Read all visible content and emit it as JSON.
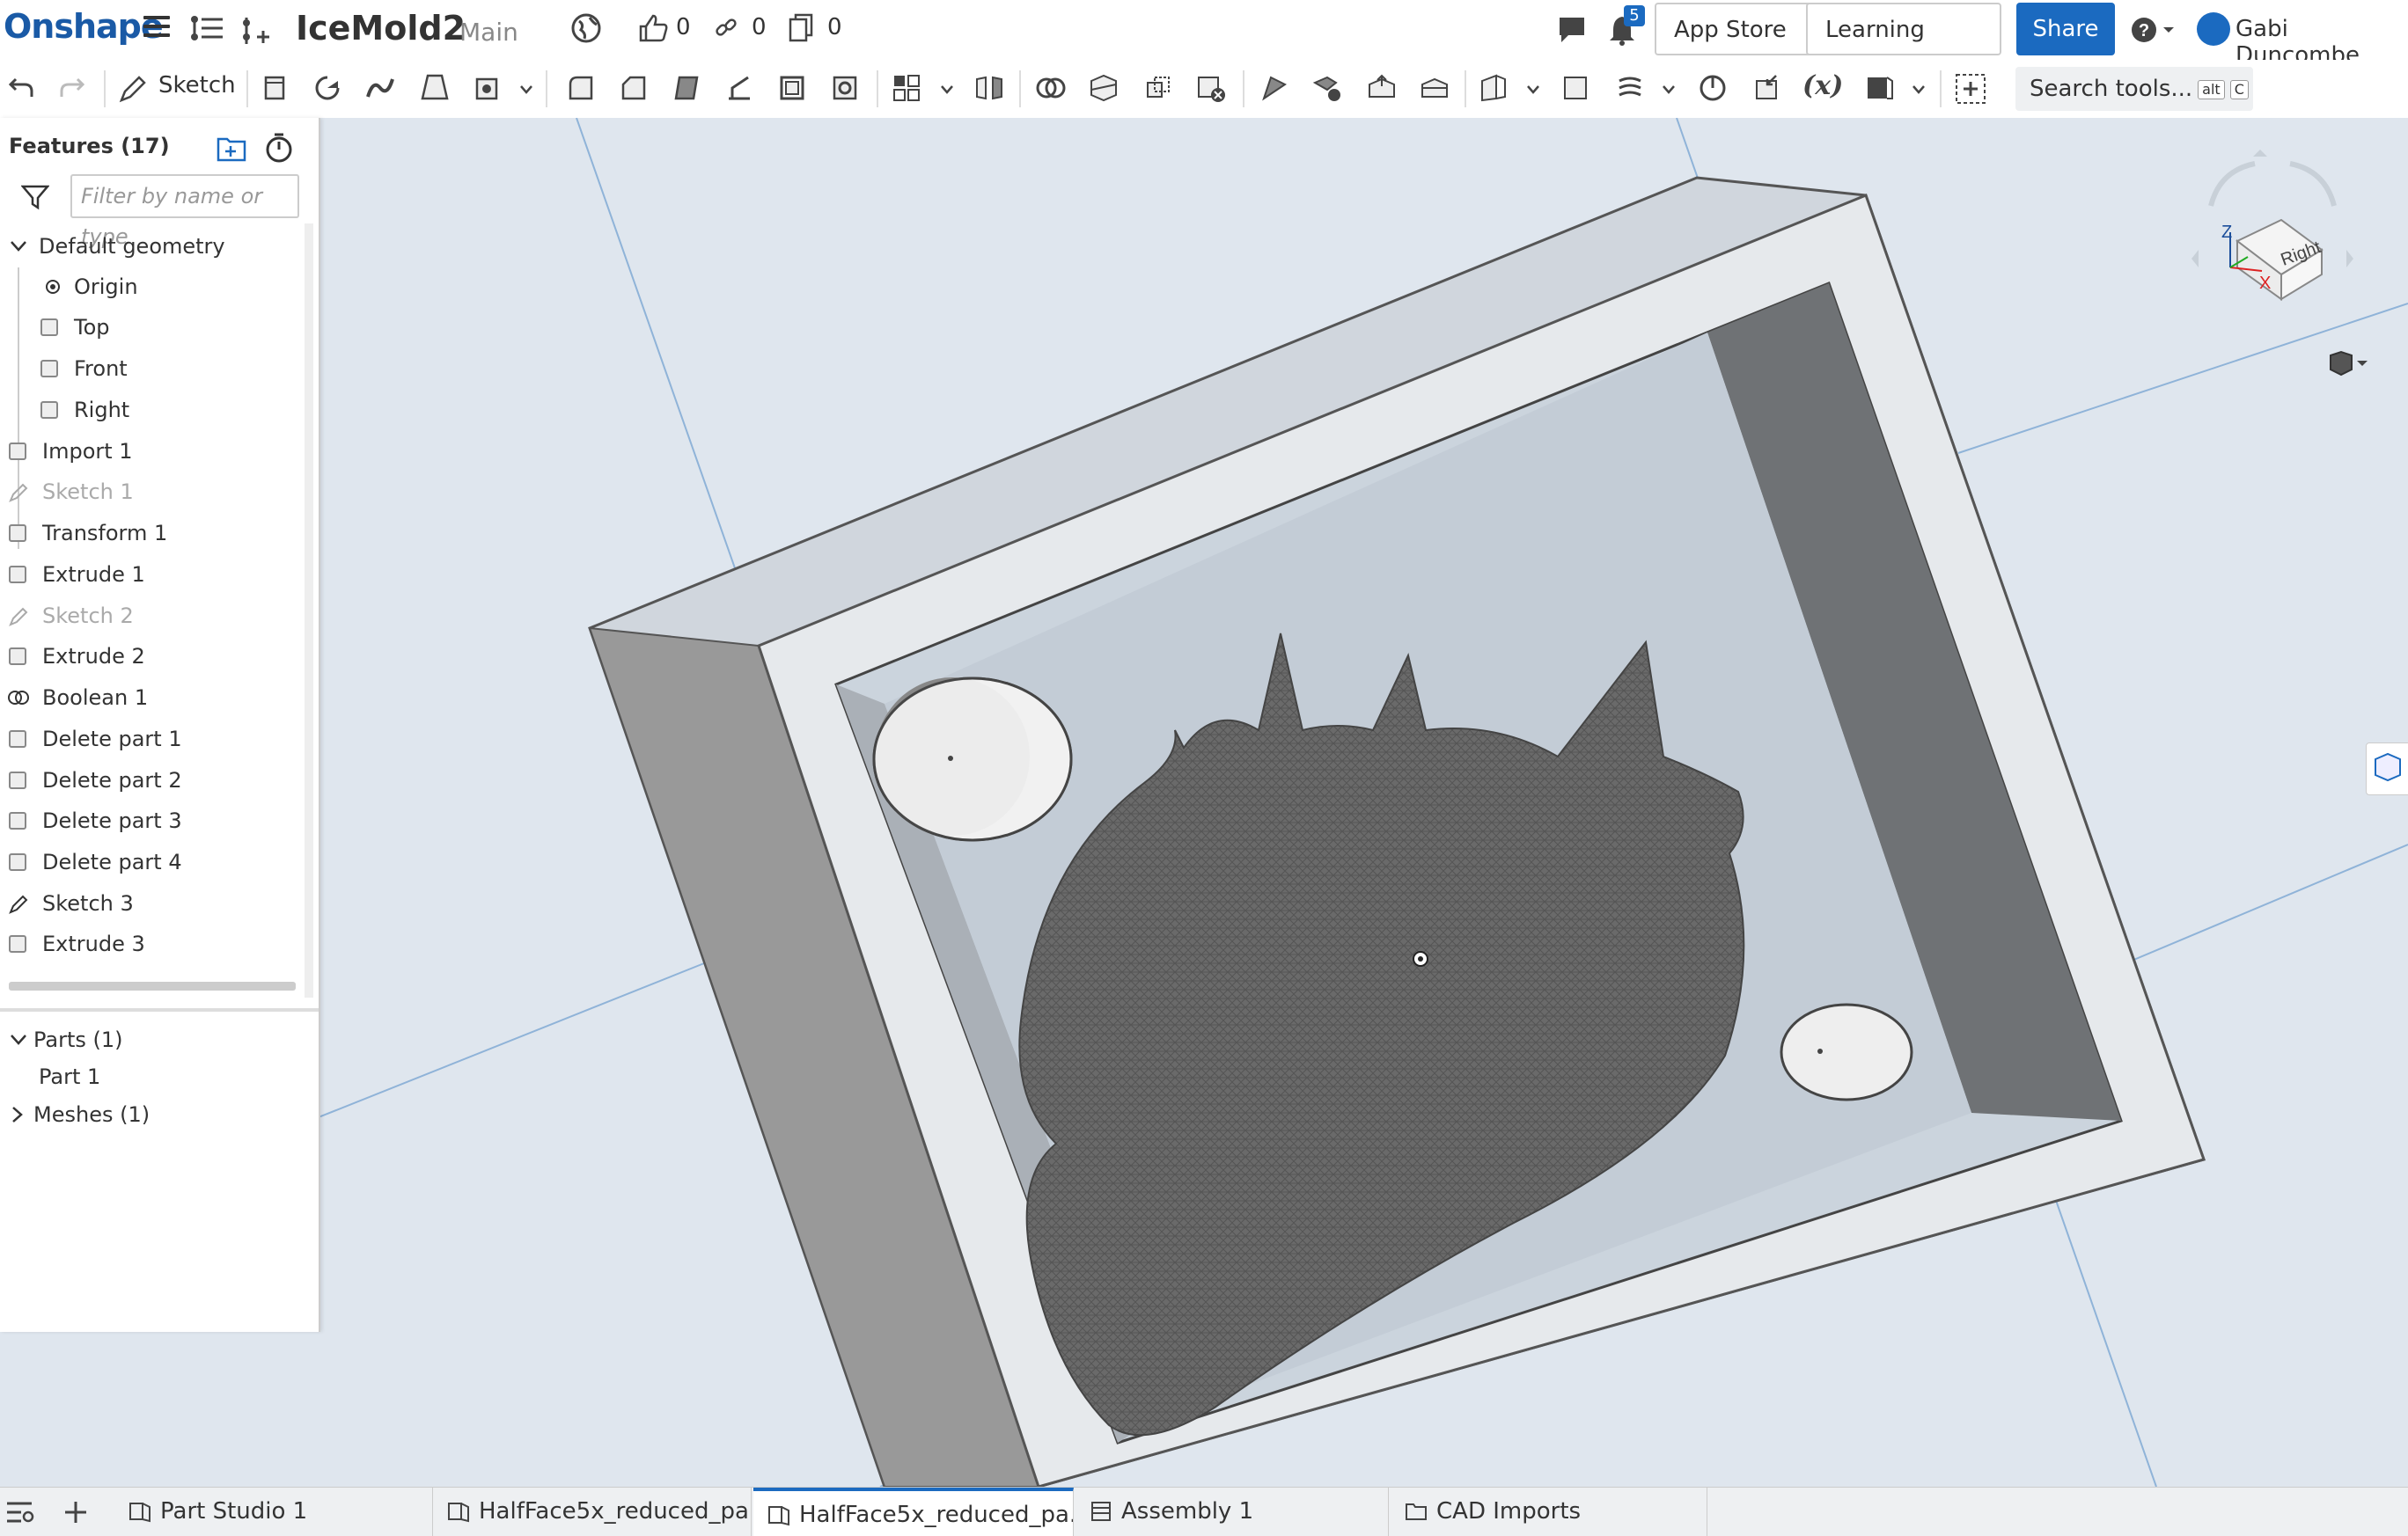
{
  "header": {
    "logo": "Onshape",
    "doc_title": "IceMold2",
    "branch": "Main",
    "likes": "0",
    "links": "0",
    "copies": "0",
    "notif_count": "5",
    "app_store": "App Store",
    "learning_center": "Learning Center",
    "share": "Share",
    "user_name": "Gabi Duncombe",
    "accent": "#1b6ac0"
  },
  "toolbar": {
    "sketch": "Sketch",
    "search_tools": "Search tools...",
    "kbd_alt": "alt",
    "kbd_c": "C"
  },
  "features": {
    "title": "Features (17)",
    "filter_placeholder": "Filter by name or type",
    "default_geometry": "Default geometry",
    "items": [
      {
        "label": "Origin"
      },
      {
        "label": "Top"
      },
      {
        "label": "Front"
      },
      {
        "label": "Right"
      },
      {
        "label": "Import 1"
      },
      {
        "label": "Sketch 1"
      },
      {
        "label": "Transform 1"
      },
      {
        "label": "Extrude 1"
      },
      {
        "label": "Sketch 2"
      },
      {
        "label": "Extrude 2"
      },
      {
        "label": "Boolean 1"
      },
      {
        "label": "Delete part 1"
      },
      {
        "label": "Delete part 2"
      },
      {
        "label": "Delete part 3"
      },
      {
        "label": "Delete part 4"
      },
      {
        "label": "Sketch 3"
      },
      {
        "label": "Extrude 3"
      }
    ]
  },
  "parts": {
    "parts_header": "Parts (1)",
    "part1": "Part 1",
    "meshes_header": "Meshes (1)"
  },
  "viewcube": {
    "face": "Right",
    "z": "Z",
    "x": "X"
  },
  "tabs": [
    {
      "label": "Part Studio 1"
    },
    {
      "label": "HalfFace5x_reduced_pa..."
    },
    {
      "label": "HalfFace5x_reduced_pa..."
    },
    {
      "label": "Assembly 1"
    },
    {
      "label": "CAD Imports"
    }
  ]
}
